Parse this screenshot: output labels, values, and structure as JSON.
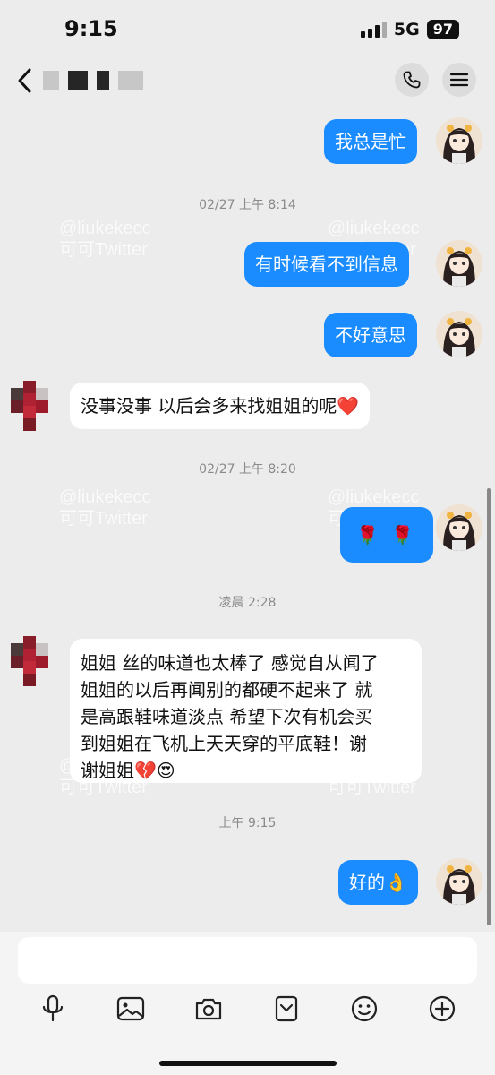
{
  "status_bar": {
    "time": "9:15",
    "network": "5G",
    "battery": "97"
  },
  "header": {
    "contact_name_obscured": true
  },
  "watermark": {
    "line1": "@liukekecc",
    "line2": "可可Twitter"
  },
  "messages": [
    {
      "kind": "out",
      "text": "我总是忙"
    },
    {
      "kind": "time",
      "text": "02/27 上午 8:14"
    },
    {
      "kind": "out",
      "text": "有时候看不到信息"
    },
    {
      "kind": "out",
      "text": "不好意思"
    },
    {
      "kind": "in",
      "text": "没事没事 以后会多来找姐姐的呢",
      "emoji": "❤️"
    },
    {
      "kind": "time",
      "text": "02/27 上午 8:20"
    },
    {
      "kind": "out",
      "text": "🌹 🌹"
    },
    {
      "kind": "time",
      "text": "凌晨 2:28"
    },
    {
      "kind": "in",
      "lines": [
        "姐姐 丝的味道也太棒了 感觉自从闻了",
        "姐姐的以后再闻别的都硬不起来了 就",
        "是高跟鞋味道淡点 希望下次有机会买",
        "到姐姐在飞机上天天穿的平底鞋！谢",
        "谢姐姐💔😍"
      ]
    },
    {
      "kind": "time",
      "text": "上午 9:15"
    },
    {
      "kind": "out",
      "text": "好的👌"
    }
  ],
  "colors": {
    "outgoing_bubble": "#1a8cff",
    "incoming_bubble": "#ffffff",
    "background": "#ececec"
  },
  "icons": [
    "back-chevron",
    "phone",
    "menu",
    "microphone",
    "image",
    "camera",
    "sticker",
    "emoji",
    "plus"
  ]
}
